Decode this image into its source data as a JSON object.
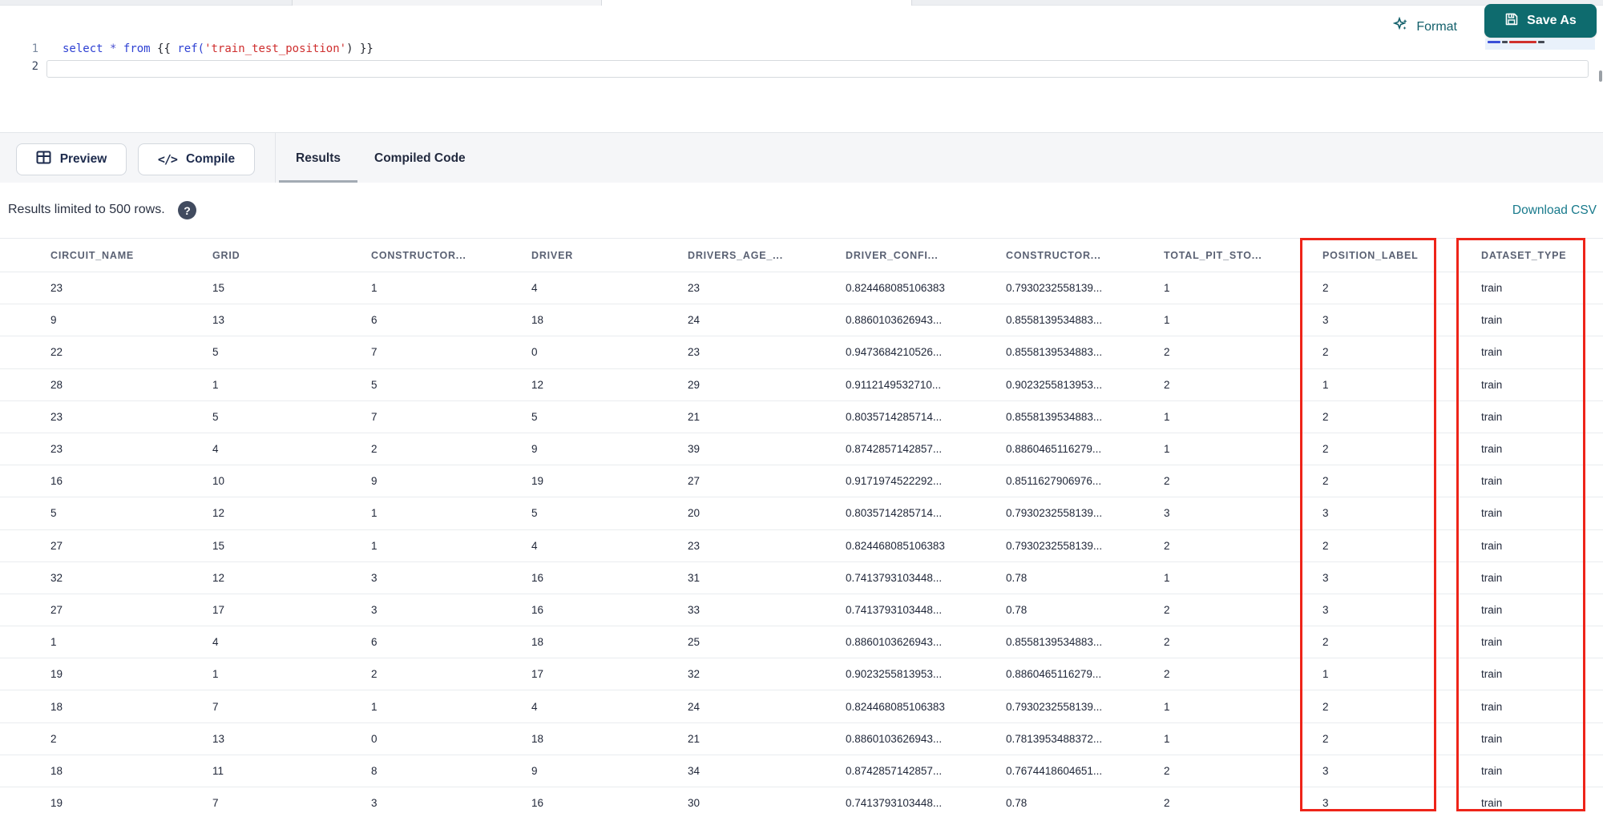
{
  "editor": {
    "line_numbers": [
      "1",
      "2"
    ],
    "code_tokens": [
      {
        "text": "select",
        "type": "keyword"
      },
      {
        "text": " ",
        "type": "plain"
      },
      {
        "text": "*",
        "type": "operator"
      },
      {
        "text": " ",
        "type": "plain"
      },
      {
        "text": "from",
        "type": "keyword"
      },
      {
        "text": " ",
        "type": "plain"
      },
      {
        "text": "{{",
        "type": "brace"
      },
      {
        "text": " ",
        "type": "plain"
      },
      {
        "text": "ref(",
        "type": "function"
      },
      {
        "text": "'train_test_position'",
        "type": "string"
      },
      {
        "text": ")",
        "type": "plain"
      },
      {
        "text": " ",
        "type": "plain"
      },
      {
        "text": "}}",
        "type": "brace"
      }
    ],
    "format_label": "Format",
    "save_as_label": "Save As"
  },
  "toolbar": {
    "preview_label": "Preview",
    "compile_label": "Compile",
    "compile_glyph": "</>",
    "tabs": [
      {
        "label": "Results",
        "active": true
      },
      {
        "label": "Compiled Code",
        "active": false
      }
    ]
  },
  "results": {
    "limit_note": "Results limited to 500 rows.",
    "help_glyph": "?",
    "download_label": "Download CSV"
  },
  "table": {
    "columns": [
      "CIRCUIT_NAME",
      "GRID",
      "CONSTRUCTOR...",
      "DRIVER",
      "DRIVERS_AGE_...",
      "DRIVER_CONFI...",
      "CONSTRUCTOR...",
      "TOTAL_PIT_STO...",
      "POSITION_LABEL",
      "DATASET_TYPE"
    ],
    "highlighted_columns": [
      "POSITION_LABEL",
      "DATASET_TYPE"
    ],
    "rows": [
      [
        "23",
        "15",
        "1",
        "4",
        "23",
        "0.824468085106383",
        "0.7930232558139...",
        "1",
        "2",
        "train"
      ],
      [
        "9",
        "13",
        "6",
        "18",
        "24",
        "0.8860103626943...",
        "0.8558139534883...",
        "1",
        "3",
        "train"
      ],
      [
        "22",
        "5",
        "7",
        "0",
        "23",
        "0.9473684210526...",
        "0.8558139534883...",
        "2",
        "2",
        "train"
      ],
      [
        "28",
        "1",
        "5",
        "12",
        "29",
        "0.9112149532710...",
        "0.9023255813953...",
        "2",
        "1",
        "train"
      ],
      [
        "23",
        "5",
        "7",
        "5",
        "21",
        "0.8035714285714...",
        "0.8558139534883...",
        "1",
        "2",
        "train"
      ],
      [
        "23",
        "4",
        "2",
        "9",
        "39",
        "0.8742857142857...",
        "0.8860465116279...",
        "1",
        "2",
        "train"
      ],
      [
        "16",
        "10",
        "9",
        "19",
        "27",
        "0.9171974522292...",
        "0.8511627906976...",
        "2",
        "2",
        "train"
      ],
      [
        "5",
        "12",
        "1",
        "5",
        "20",
        "0.8035714285714...",
        "0.7930232558139...",
        "3",
        "3",
        "train"
      ],
      [
        "27",
        "15",
        "1",
        "4",
        "23",
        "0.824468085106383",
        "0.7930232558139...",
        "2",
        "2",
        "train"
      ],
      [
        "32",
        "12",
        "3",
        "16",
        "31",
        "0.7413793103448...",
        "0.78",
        "1",
        "3",
        "train"
      ],
      [
        "27",
        "17",
        "3",
        "16",
        "33",
        "0.7413793103448...",
        "0.78",
        "2",
        "3",
        "train"
      ],
      [
        "1",
        "4",
        "6",
        "18",
        "25",
        "0.8860103626943...",
        "0.8558139534883...",
        "2",
        "2",
        "train"
      ],
      [
        "19",
        "1",
        "2",
        "17",
        "32",
        "0.9023255813953...",
        "0.8860465116279...",
        "2",
        "1",
        "train"
      ],
      [
        "18",
        "7",
        "1",
        "4",
        "24",
        "0.824468085106383",
        "0.7930232558139...",
        "1",
        "2",
        "train"
      ],
      [
        "2",
        "13",
        "0",
        "18",
        "21",
        "0.8860103626943...",
        "0.7813953488372...",
        "1",
        "2",
        "train"
      ],
      [
        "18",
        "11",
        "8",
        "9",
        "34",
        "0.8742857142857...",
        "0.7674418604651...",
        "2",
        "3",
        "train"
      ],
      [
        "19",
        "7",
        "3",
        "16",
        "30",
        "0.7413793103448...",
        "0.78",
        "2",
        "3",
        "train"
      ]
    ]
  },
  "colors": {
    "accent_teal": "#0e6b6e",
    "link_teal": "#187a8c",
    "highlight_red": "#ee2419",
    "keyword_blue": "#2e41d3",
    "string_red": "#cf2f2f"
  }
}
